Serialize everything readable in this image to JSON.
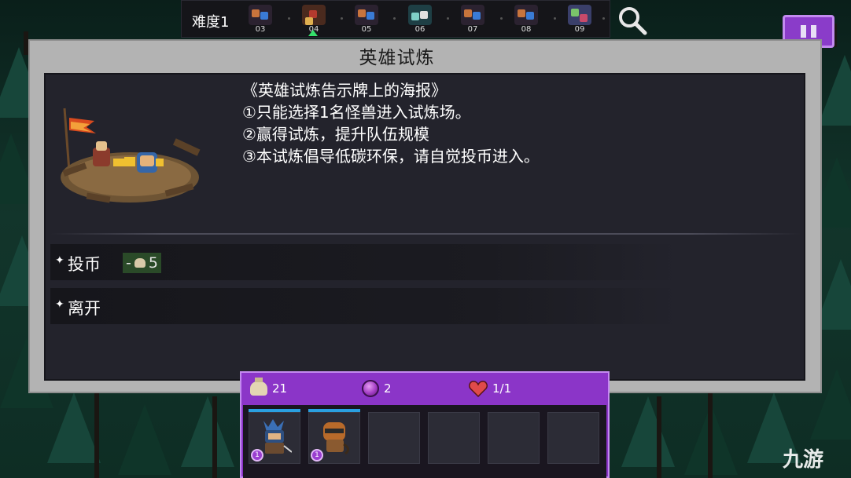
{
  "top": {
    "difficulty_label": "难度1",
    "stages": [
      "03",
      "04",
      "05",
      "06",
      "07",
      "08",
      "09"
    ],
    "current_stage": "04",
    "search_icon": "search-icon",
    "pause_icon": "pause-icon"
  },
  "panel": {
    "title": "英雄试炼",
    "poster_lines": [
      "《英雄试炼告示牌上的海报》",
      "①只能选择1名怪兽进入试炼场。",
      "②赢得试炼，提升队伍规模",
      "③本试炼倡导低碳环保，请自觉投币进入。"
    ]
  },
  "options": [
    {
      "label": "投币",
      "cost_prefix": "-",
      "cost_value": "5",
      "cost_icon": "coin-bag-icon"
    },
    {
      "label": "离开"
    }
  ],
  "inventory": {
    "bag_count": "21",
    "gem_count": "2",
    "hearts": "1/1",
    "slots": [
      {
        "filled": true,
        "level": "1",
        "hero": "knight-monster"
      },
      {
        "filled": true,
        "level": "1",
        "hero": "helmet-monster"
      },
      {
        "filled": false
      },
      {
        "filled": false
      },
      {
        "filled": false
      },
      {
        "filled": false
      }
    ]
  },
  "watermark": "九游",
  "colors": {
    "accent_purple": "#8b35c8",
    "panel_grey": "#b3b3b3",
    "inner_dark": "#23232c",
    "cost_green": "#2a4a28",
    "current_marker": "#35e06b"
  }
}
